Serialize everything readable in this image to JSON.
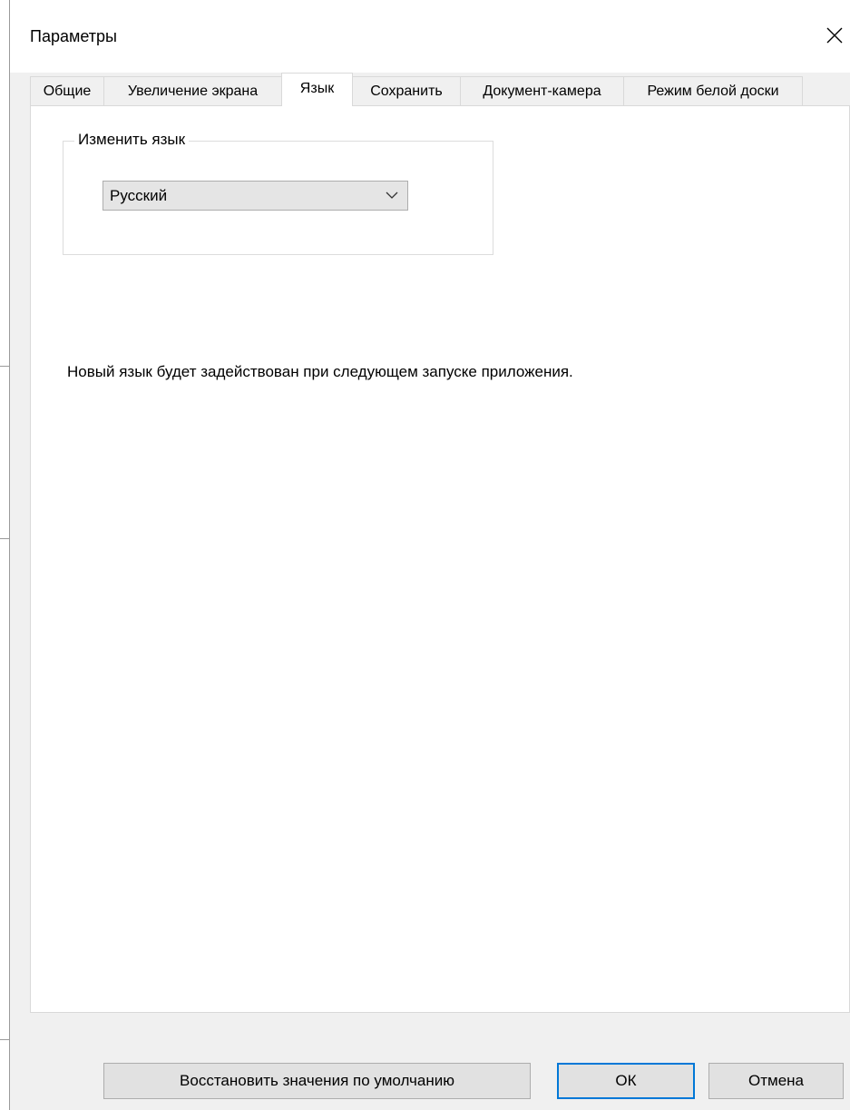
{
  "window": {
    "title": "Параметры",
    "close_icon": "close-icon"
  },
  "tabs": [
    {
      "label": "Общие",
      "active": false
    },
    {
      "label": "Увеличение экрана",
      "active": false
    },
    {
      "label": "Язык",
      "active": true
    },
    {
      "label": "Сохранить",
      "active": false
    },
    {
      "label": "Документ-камера",
      "active": false
    },
    {
      "label": "Режим белой доски",
      "active": false
    }
  ],
  "language_group": {
    "label": "Изменить язык",
    "select_value": "Русский",
    "arrow_icon": "chevron-down-icon"
  },
  "info_text": "Новый язык будет задействован при следующем запуске приложения.",
  "buttons": {
    "restore": "Восстановить значения по умолчанию",
    "ok": "ОК",
    "cancel": "Отмена"
  },
  "colors": {
    "dialog_bg": "#f0f0f0",
    "panel_bg": "#ffffff",
    "default_button_border": "#0078d7"
  }
}
